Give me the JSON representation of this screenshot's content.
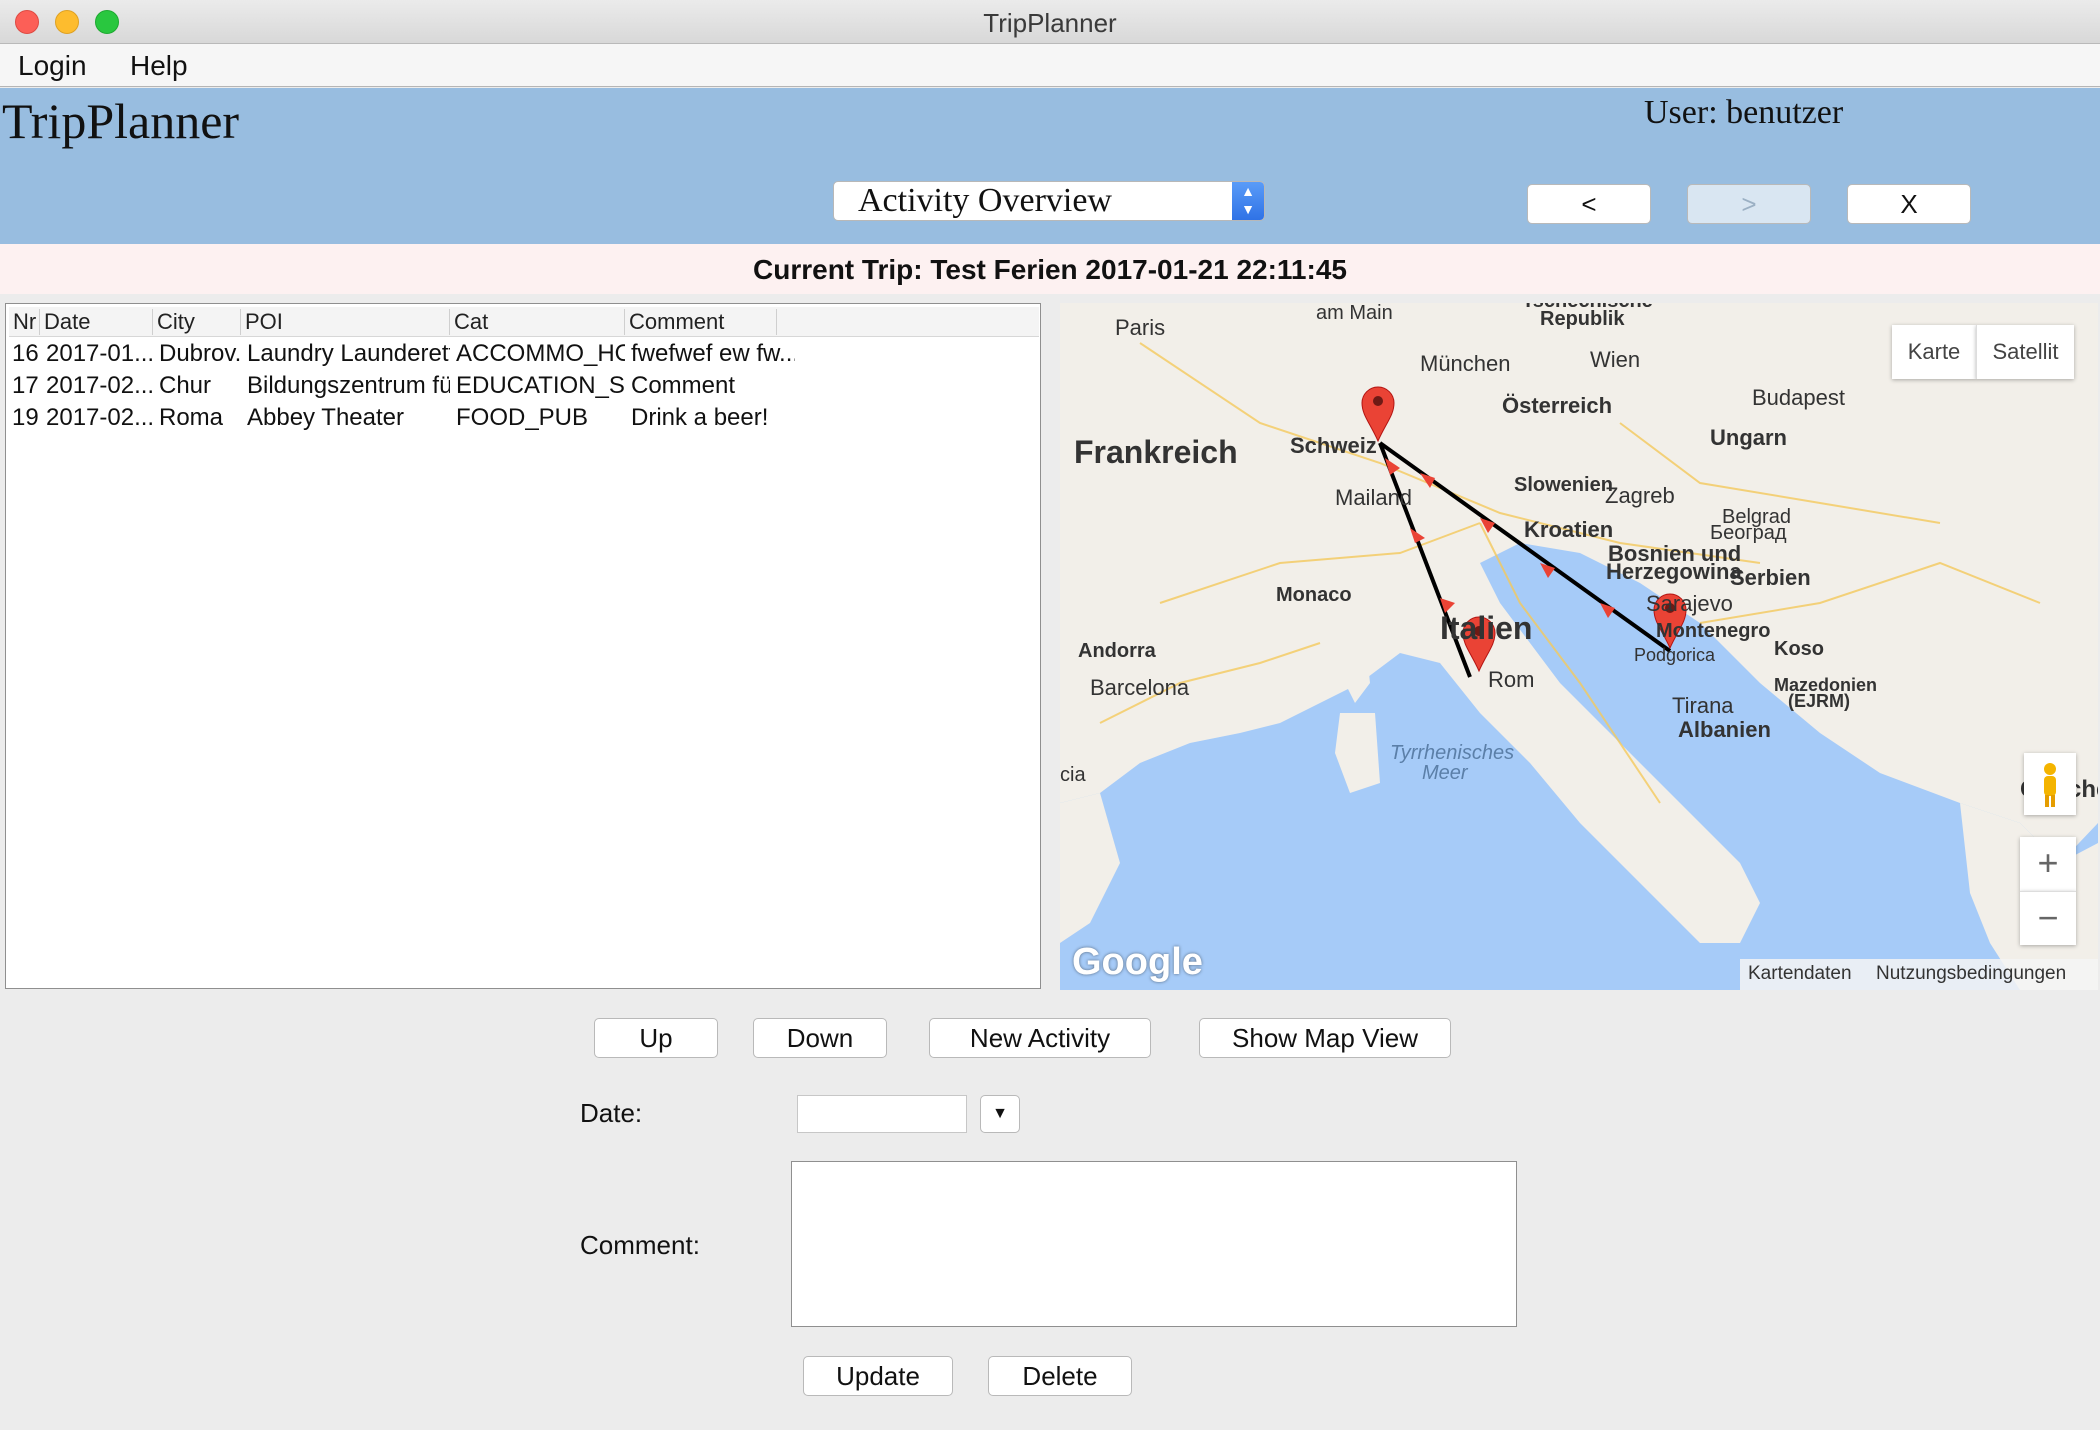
{
  "window": {
    "title": "TripPlanner"
  },
  "menu": {
    "items": [
      "Login",
      "Help"
    ]
  },
  "header": {
    "app_title": "TripPlanner",
    "user_label": "User: benutzer",
    "view_select": "Activity Overview",
    "nav_prev": "<",
    "nav_next": ">",
    "nav_close": "X"
  },
  "trip": {
    "label": "Current Trip: Test Ferien 2017-01-21 22:11:45"
  },
  "table": {
    "columns": [
      "Nr",
      "Date",
      "City",
      "POI",
      "Cat",
      "Comment"
    ],
    "rows": [
      {
        "nr": "16",
        "date": "2017-01...",
        "city": "Dubrov...",
        "poi": "Laundry Launderette",
        "cat": "ACCOMMO_HOTEL",
        "comment": "fwefwef ew fw..."
      },
      {
        "nr": "17",
        "date": "2017-02...",
        "city": "Chur",
        "poi": "Bildungszentrum für ...",
        "cat": "EDUCATION_SCH...",
        "comment": "Comment"
      },
      {
        "nr": "19",
        "date": "2017-02...",
        "city": "Roma",
        "poi": "Abbey Theater",
        "cat": "FOOD_PUB",
        "comment": "Drink a beer!"
      }
    ]
  },
  "map": {
    "type_buttons": [
      "Karte",
      "Satellit"
    ],
    "zoom_in": "+",
    "zoom_out": "−",
    "logo": "Google",
    "footer": [
      "Kartendaten",
      "Nutzungsbedingungen"
    ],
    "labels": {
      "am_main": "am Main",
      "tschechische": "Tschechische",
      "republik": "Republik",
      "paris": "Paris",
      "muenchen": "München",
      "wien": "Wien",
      "budapest": "Budapest",
      "oesterreich": "Österreich",
      "ungarn": "Ungarn",
      "frankreich": "Frankreich",
      "schweiz": "Schweiz",
      "slowenien": "Slowenien",
      "zagreb": "Zagreb",
      "mailand": "Mailand",
      "kroatien": "Kroatien",
      "belgrad": "Belgrad",
      "beograd": "Београд",
      "bosnien": "Bosnien und",
      "herzegowina": "Herzegowina",
      "serbien": "Serbien",
      "monaco": "Monaco",
      "sarajevo": "Sarajevo",
      "italien": "Italien",
      "montenegro": "Montenegro",
      "andorra": "Andorra",
      "podgorica": "Podgorica",
      "kosovo": "Koso",
      "rom": "Rom",
      "mazedonien": "Mazedonien",
      "fjrm": "(EJRM)",
      "barcelona": "Barcelona",
      "tirana": "Tirana",
      "albanien": "Albanien",
      "tyrrhenisches": "Tyrrhenisches",
      "meer": "Meer",
      "griechenland": "Grieche",
      "cia": "cia"
    },
    "colors": {
      "land": "#f2efe9",
      "sea": "#a6cbf8",
      "route": "#000000",
      "marker": "#ea4335"
    }
  },
  "actions": {
    "up": "Up",
    "down": "Down",
    "new_activity": "New Activity",
    "show_map": "Show Map View"
  },
  "form": {
    "date_label": "Date:",
    "date_value": "",
    "comment_label": "Comment:",
    "comment_value": "",
    "update": "Update",
    "delete": "Delete"
  }
}
